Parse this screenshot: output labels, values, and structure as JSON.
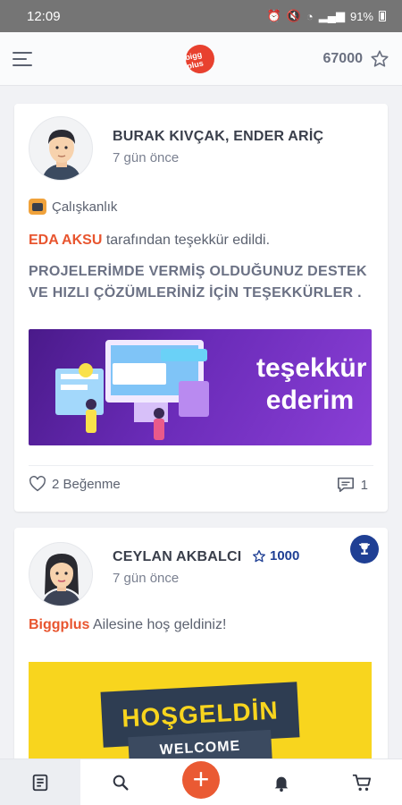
{
  "status": {
    "time": "12:09",
    "battery": "91%"
  },
  "header": {
    "points": "67000",
    "logo_text": "bigg plus",
    "menu_icon": "menu-icon",
    "star_icon": "star-outline-icon"
  },
  "posts": [
    {
      "author": "BURAK KIVÇAK, ENDER ARİÇ",
      "time": "7 gün önce",
      "badge": "Çalışkanlık",
      "thanked_by": "EDA AKSU",
      "thanks_suffix": "tarafından teşekkür edildi.",
      "message": "PROJELERİMDE VERMİŞ OLDUĞUNUZ DESTEK VE HIZLI ÇÖZÜMLERİNİZ İÇİN TEŞEKKÜRLER .",
      "banner_line1": "teşekkür",
      "banner_line2": "ederim",
      "likes": "2 Beğenme",
      "comments": "1"
    },
    {
      "author": "CEYLAN AKBALCI",
      "points": "1000",
      "time": "7 gün önce",
      "brand": "Biggplus",
      "welcome_suffix": "Ailesine hoş geldiniz!",
      "banner_line1": "HOŞGELDİN",
      "banner_line2": "WELCOME"
    }
  ],
  "colors": {
    "accent": "#e8552f",
    "navy": "#1f3f94",
    "banner_purple": "#6a2bb8",
    "banner_yellow": "#f8d51e"
  }
}
